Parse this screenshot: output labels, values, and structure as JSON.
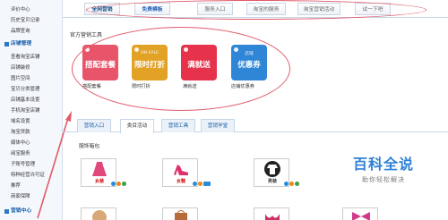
{
  "sidebar": {
    "items_top": [
      "评价中心",
      "历史宝贝记录",
      "品牌查询"
    ],
    "shop_manage_head": "店铺管理",
    "shop_items": [
      "查看淘宝店铺",
      "店铺装修",
      "图片空间",
      "宝贝分类管理",
      "店铺基本设置",
      "手机淘宝店铺",
      "域名设置",
      "淘宝贷款",
      "媒体中心",
      "阅宝服务",
      "子账号管理",
      "特种经营许可证",
      "推荐",
      "商家保障"
    ],
    "marketing_head": "营销中心"
  },
  "topbar": {
    "tabs": [
      {
        "label": "全网营销",
        "state": "active"
      },
      {
        "label": "免费模板",
        "state": "highlight"
      },
      {
        "label": "服务入口",
        "state": ""
      },
      {
        "label": "淘宝的服务",
        "state": ""
      },
      {
        "label": "淘宝营销活动",
        "state": ""
      },
      {
        "label": "试一下吧",
        "state": ""
      }
    ]
  },
  "official_tools": {
    "title": "官方营销工具",
    "tools": [
      {
        "small": "",
        "big": "搭配套餐",
        "caption": "搭配套餐",
        "color": "#e8556a"
      },
      {
        "small": "ON SALE",
        "big": "限时打折",
        "caption": "限时打折",
        "color": "#e2a225"
      },
      {
        "small": "",
        "big": "满就送",
        "caption": "满就送",
        "color": "#e6324a"
      },
      {
        "small": "店铺",
        "big": "优惠券",
        "caption": "店铺优惠券",
        "color": "#2f86d6"
      }
    ]
  },
  "subtabs": {
    "tabs": [
      {
        "label": "营销入口",
        "active": false
      },
      {
        "label": "类目活动",
        "active": true
      },
      {
        "label": "营销工具",
        "active": false
      },
      {
        "label": "营销学堂",
        "active": false
      }
    ]
  },
  "category": {
    "title": "服饰箱包",
    "tiles": [
      {
        "label": "女装",
        "icon": "dress-icon"
      },
      {
        "label": "女鞋",
        "icon": "high-heel-icon"
      },
      {
        "label": "男装",
        "icon": "mens-shirt-icon"
      }
    ],
    "tiles_row2": [
      {
        "icon": "ball-icon"
      },
      {
        "icon": "bag-icon"
      },
      {
        "icon": "underwear-icon"
      },
      {
        "icon": "bow-icon"
      }
    ]
  },
  "watermark": {
    "title": "百科全说",
    "subtitle": "助你轻松解决"
  },
  "colors": {
    "accent": "#2a78c8",
    "annotation": "#e05a6a"
  }
}
